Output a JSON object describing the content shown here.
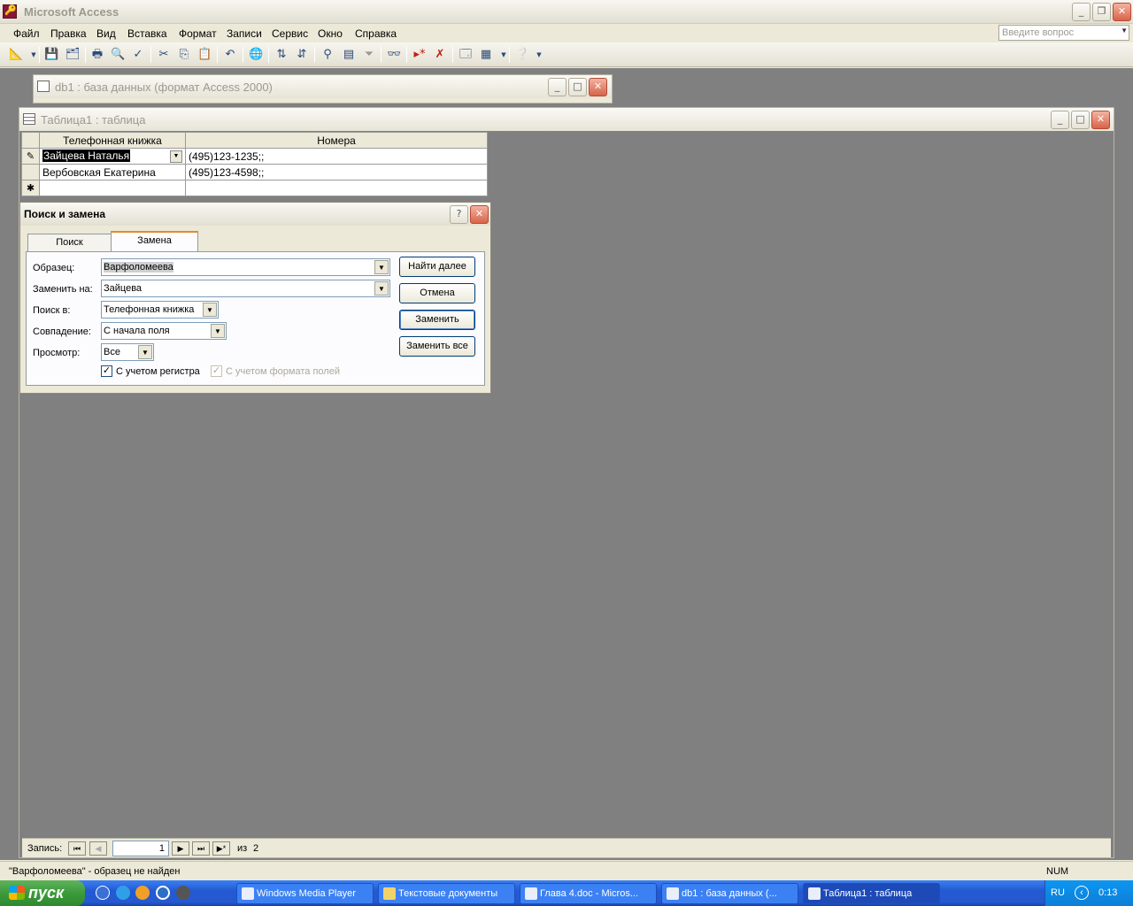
{
  "app": {
    "title": "Microsoft Access"
  },
  "menu": [
    "Файл",
    "Правка",
    "Вид",
    "Вставка",
    "Формат",
    "Записи",
    "Сервис",
    "Окно",
    "Справка"
  ],
  "ask": {
    "placeholder": "Введите вопрос"
  },
  "db_window": {
    "title": "db1 : база данных (формат Access 2000)"
  },
  "table_window": {
    "title": "Таблица1 : таблица",
    "columns": [
      "Телефонная книжка",
      "Номера"
    ],
    "rows": [
      {
        "name": "Зайцева Наталья",
        "phone": "(495)123-1235;;"
      },
      {
        "name": "Вербовская Екатерина",
        "phone": "(495)123-4598;;"
      }
    ]
  },
  "dialog": {
    "title": "Поиск и замена",
    "tabs": [
      "Поиск",
      "Замена"
    ],
    "find_label": "Образец:",
    "find_value": "Варфоломеева",
    "replace_label": "Заменить на:",
    "replace_value": "Зайцева",
    "look_in_label": "Поиск в:",
    "look_in_value": "Телефонная книжка",
    "match_label": "Совпадение:",
    "match_value": "С начала поля",
    "search_label": "Просмотр:",
    "search_value": "Все",
    "match_case_label": "С учетом регистра",
    "match_format_label": "С учетом формата полей",
    "buttons": {
      "find_next": "Найти далее",
      "cancel": "Отмена",
      "replace": "Заменить",
      "replace_all": "Заменить все"
    }
  },
  "record_nav": {
    "label": "Запись:",
    "current": "1",
    "of_label": "из",
    "total": "2"
  },
  "status": {
    "message": "\"Варфоломеева\" - образец не найден",
    "num": "NUM"
  },
  "taskbar": {
    "start": "пуск",
    "tasks": [
      "Windows Media Player",
      "Текстовые документы",
      "Глава 4.doc - Micros...",
      "db1 : база данных (...",
      "Таблица1 : таблица"
    ],
    "lang": "RU",
    "clock": "0:13"
  }
}
